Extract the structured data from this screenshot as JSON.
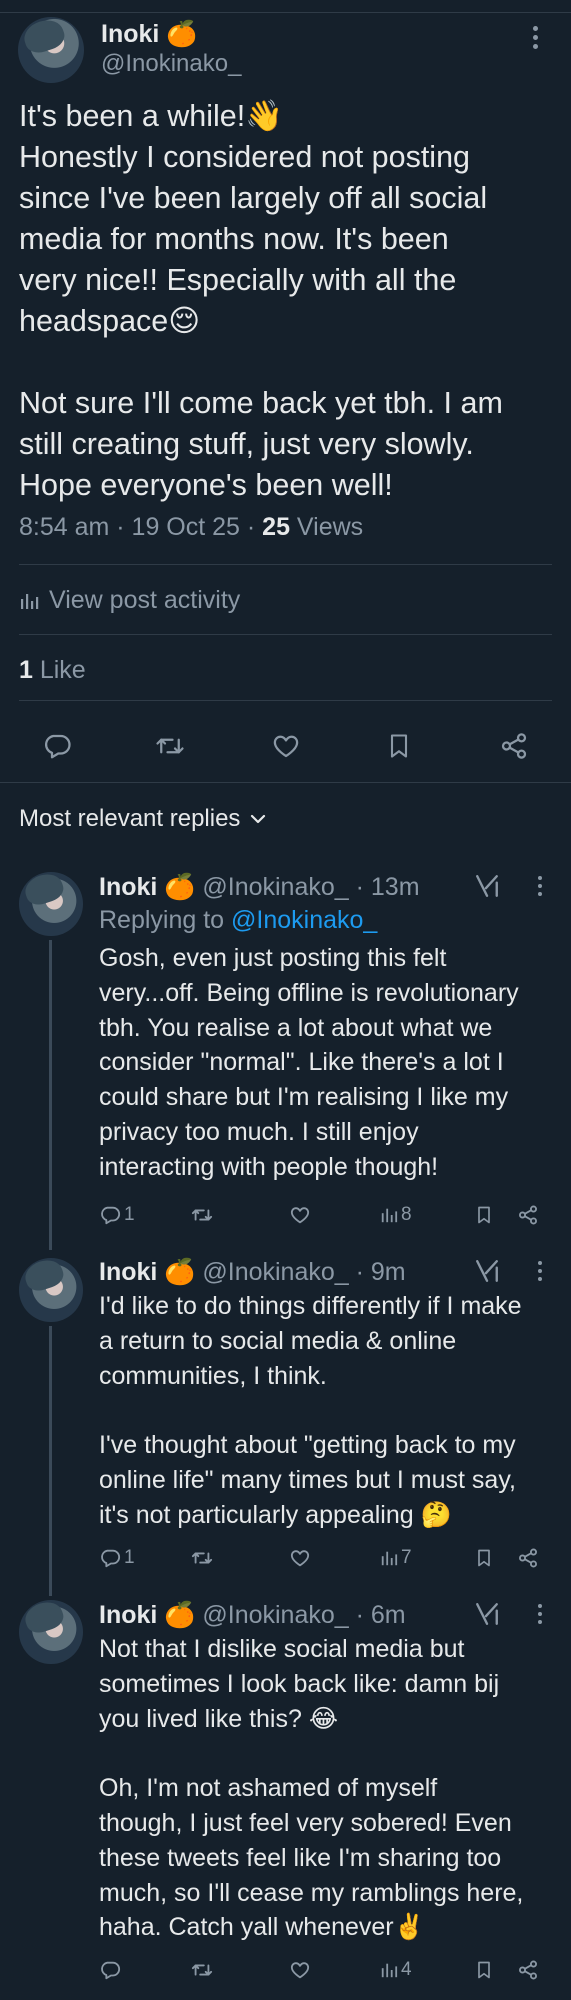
{
  "post": {
    "author_name": "Inoki 🍊",
    "author_handle": "@Inokinako_",
    "lines": [
      "It's been a while!👋",
      "Honestly I considered not posting",
      "since I've been largely off all social",
      "media for months now. It's been",
      "very nice!! Especially with all the",
      "headspace😌",
      "",
      "Not sure I'll come back yet tbh. I am",
      "still creating stuff, just very slowly.",
      "Hope everyone's been well!"
    ],
    "timestamp": "8:54 am · 19 Oct 25 · ",
    "views_count": "25",
    "views_label": " Views",
    "activity_label": "View post activity",
    "likes_count": "1",
    "likes_label": " Like"
  },
  "sort_label": "Most relevant replies",
  "replies": [
    {
      "name": "Inoki 🍊",
      "handle": " @Inokinako_ · 13m",
      "replying_prefix": "Replying to ",
      "replying_handle": "@Inokinako_",
      "lines": [
        "Gosh, even just posting this felt",
        "very...off. Being offline is revolutionary",
        "tbh. You realise a lot about what we",
        "consider \"normal\". Like there's a lot I",
        "could share but I'm realising I like my",
        "privacy too much. I still enjoy",
        "interacting with people though!"
      ],
      "reply_count": "1",
      "view_count": "8"
    },
    {
      "name": "Inoki 🍊",
      "handle": " @Inokinako_ · 9m",
      "lines": [
        "I'd like to do things differently if I make",
        "a return to social media & online",
        "communities, I think.",
        "",
        "I've thought about \"getting back to my",
        "online life\" many times but I must say,",
        "it's not particularly appealing 🤔"
      ],
      "reply_count": "1",
      "view_count": "7"
    },
    {
      "name": "Inoki 🍊",
      "handle": " @Inokinako_ · 6m",
      "lines": [
        "Not that I dislike social media but",
        "sometimes I look back like: damn bij",
        "you lived like this? 😂",
        "",
        "Oh, I'm not ashamed of myself",
        "though, I just feel very sobered! Even",
        "these tweets feel like I'm sharing too",
        "much, so I'll cease my ramblings here,",
        "haha. Catch yall whenever✌️"
      ],
      "reply_count": "",
      "view_count": "4"
    }
  ],
  "icons": {
    "reply": "speech-bubble-icon",
    "retweet": "retweet-icon",
    "like": "heart-icon",
    "bookmark": "bookmark-icon",
    "share": "share-icon",
    "views": "bar-chart-icon",
    "grok": "grok-icon",
    "more": "more-vertical-icon",
    "chevron": "chevron-down-icon"
  },
  "colors": {
    "background": "#15202b",
    "text": "#e7e9ea",
    "muted": "#8b98a5",
    "link": "#1d9bf0",
    "divider": "#2f3b47"
  }
}
